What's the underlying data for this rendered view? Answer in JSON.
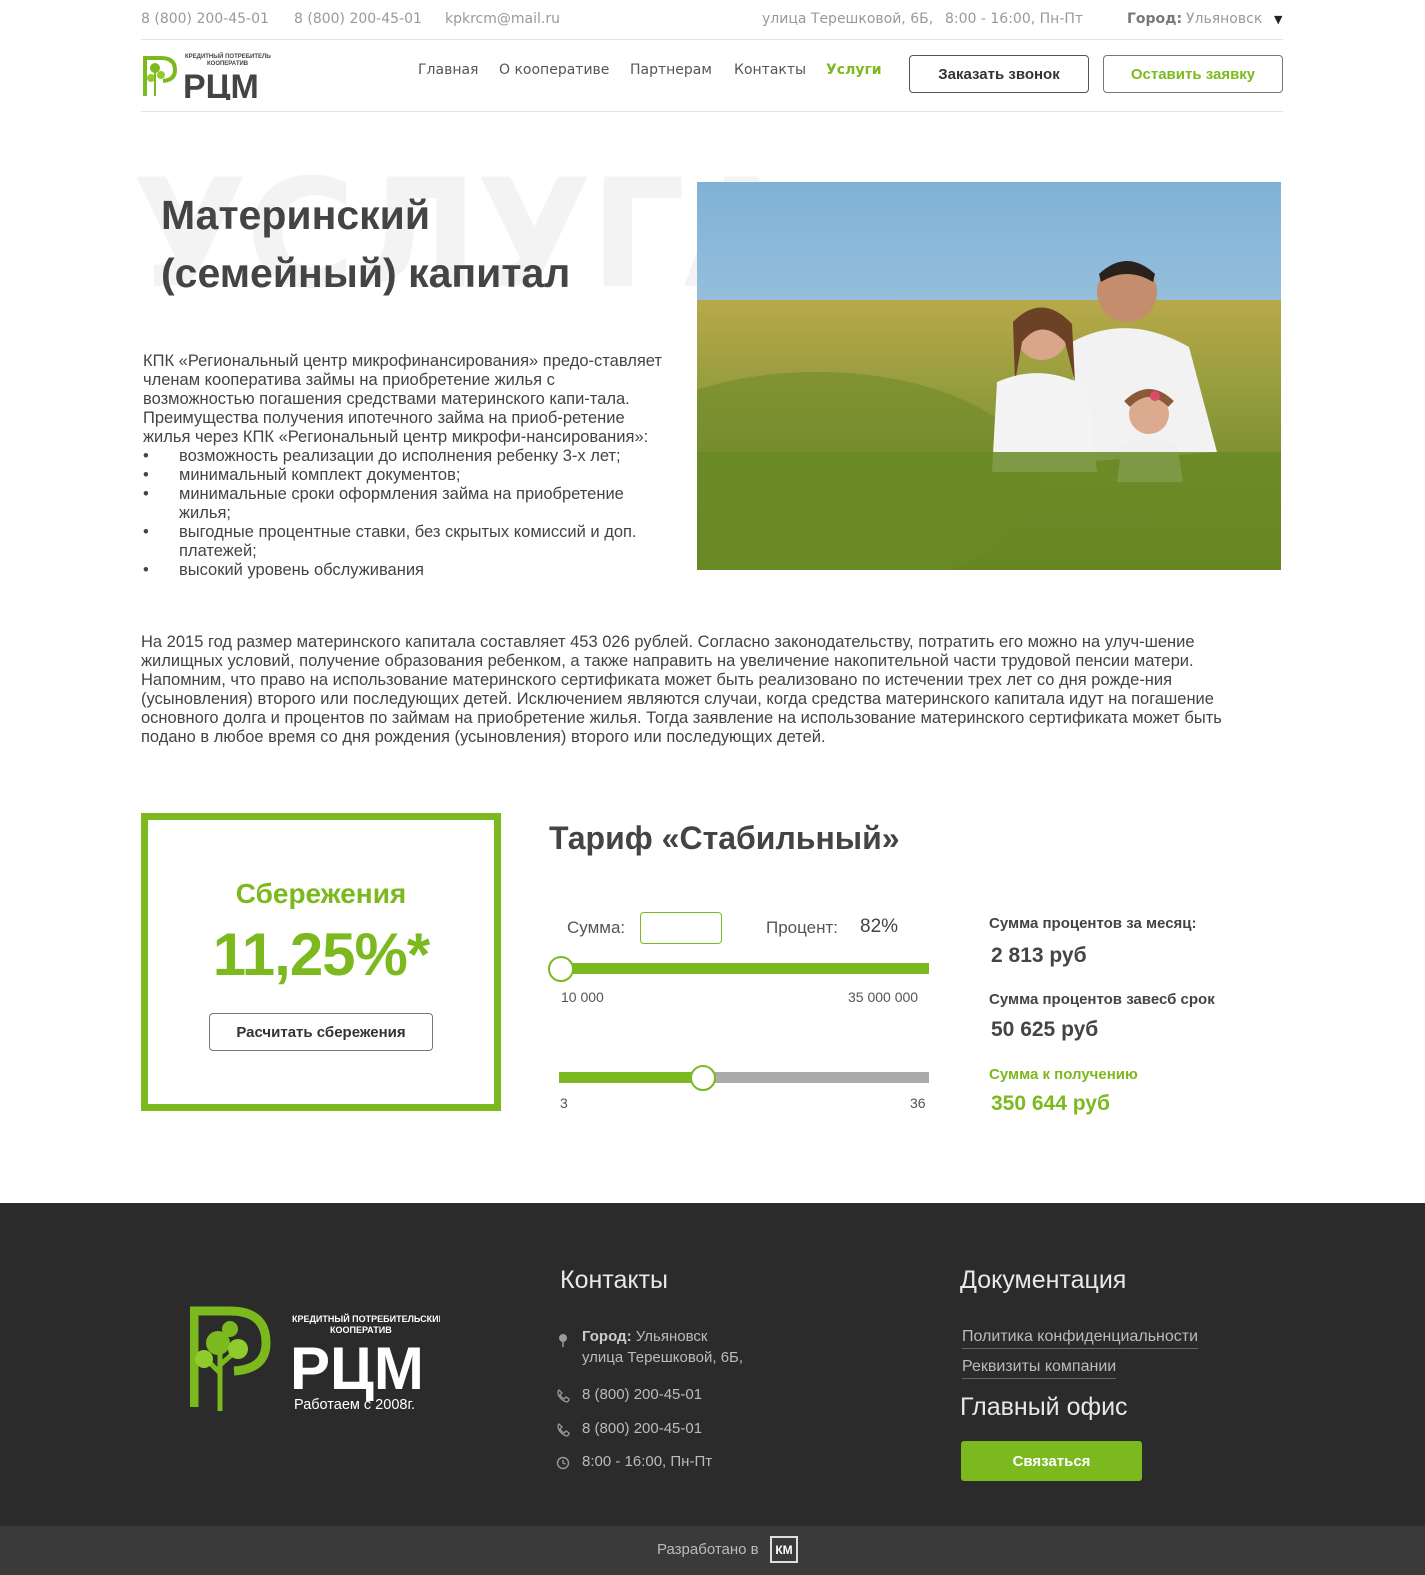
{
  "topbar": {
    "phone1": "8 (800) 200-45-01",
    "phone2": "8 (800) 200-45-01",
    "email": "kpkrcm@mail.ru",
    "address": "улица Терешковой, 6Б,",
    "hours": "8:00 - 16:00, Пн-Пт",
    "city_label": "Город:",
    "city_value": "Ульяновск",
    "city_caret": "▼"
  },
  "logo": {
    "tagline_line1": "КРЕДИТНЫЙ ПОТРЕБИТЕЛЬСКИЙ",
    "tagline_line2": "КООПЕРАТИВ",
    "brand": "РЦМ"
  },
  "nav": {
    "items": [
      {
        "label": "Главная"
      },
      {
        "label": "О кооперативе"
      },
      {
        "label": "Партнерам"
      },
      {
        "label": "Контакты"
      },
      {
        "label": "Услуги"
      }
    ],
    "call_button": "Заказать звонок",
    "apply_button": "Оставить заявку"
  },
  "hero": {
    "bg_word": "УСЛУГА",
    "title_line1": "Материнский",
    "title_line2": "(семейный) капитал",
    "intro": "КПК «Региональный центр микрофинансирования» предо-ставляет членам кооператива займы на приобретение жилья с возможностью погашения средствами материнского капи-тала. Преимущества получения ипотечного займа на приоб-ретение жилья через КПК «Региональный центр микрофи-нансирования»:",
    "bullets": [
      "возможность реализации до исполнения ребенку 3-х лет;",
      "минимальный комплект документов;",
      "минимальные сроки оформления займа на приобретение жилья;",
      "выгодные процентные ставки, без скрытых комиссий и доп. платежей;",
      "высокий уровень обслуживания"
    ]
  },
  "info": {
    "p1": "На 2015 год размер материнского капитала составляет 453 026 рублей. Согласно законодательству, потратить его можно на улуч-шение жилищных условий, получение образования ребенком, а также направить на увеличение накопительной части трудовой пенсии матери.",
    "p2": "Напомним, что право на использование материнского сертификата может быть реализовано по истечении трех лет со дня рожде-ния (усыновления) второго или последующих детей. Исключением являются случаи, когда средства материнского капитала идут на погашение основного долга и процентов по займам на приобретение жилья. Тогда заявление на использование материнского сертификата может быть подано в любое время со дня рождения (усыновления) второго или последующих детей."
  },
  "savings": {
    "title": "Сбережения",
    "rate": "11,25%*",
    "button": "Расчитать сбережения"
  },
  "tariff": {
    "title": "Тариф «Стабильный»",
    "sum_label": "Сумма:",
    "sum_value": "",
    "percent_label": "Процент:",
    "percent_value": "82%",
    "slider1": {
      "min_label": "10 000",
      "max_label": "35 000 000",
      "level": 0.0
    },
    "slider2": {
      "min_label": "3",
      "max_label": "36",
      "level": 0.39
    },
    "month_label": "Сумма процентов за месяц:",
    "month_value": "2 813 руб",
    "term_label": "Сумма процентов завесб срок",
    "term_value": "50 625 руб",
    "receive_label": "Сумма к получению",
    "receive_value": "350 644 руб"
  },
  "footer": {
    "logo_tagline_line1": "КРЕДИТНЫЙ ПОТРЕБИТЕЛЬСКИЙ",
    "logo_tagline_line2": "КООПЕРАТИВ",
    "logo_brand": "РЦМ",
    "since": "Работаем с 2008г.",
    "contacts_title": "Контакты",
    "city_label": "Город:",
    "city_value": "Ульяновск",
    "address": "улица Терешковой, 6Б,",
    "phone1": "8 (800) 200-45-01",
    "phone2": "8 (800) 200-45-01",
    "hours": "8:00 - 16:00, Пн-Пт",
    "docs_title": "Документация",
    "privacy_link": "Политика конфиденциальности",
    "requisites_link": "Реквизиты компании",
    "office_title": "Главный офис",
    "contact_button": "Связаться",
    "developed": "Разработано в",
    "dev_logo": "КМ"
  },
  "colors": {
    "accent": "#7cb91e",
    "footer_bg": "#2b2b2b",
    "text": "#444444"
  },
  "icons": [
    "caret-down-icon",
    "map-pin-icon",
    "phone-icon",
    "clock-icon",
    "tree-logo-icon"
  ]
}
